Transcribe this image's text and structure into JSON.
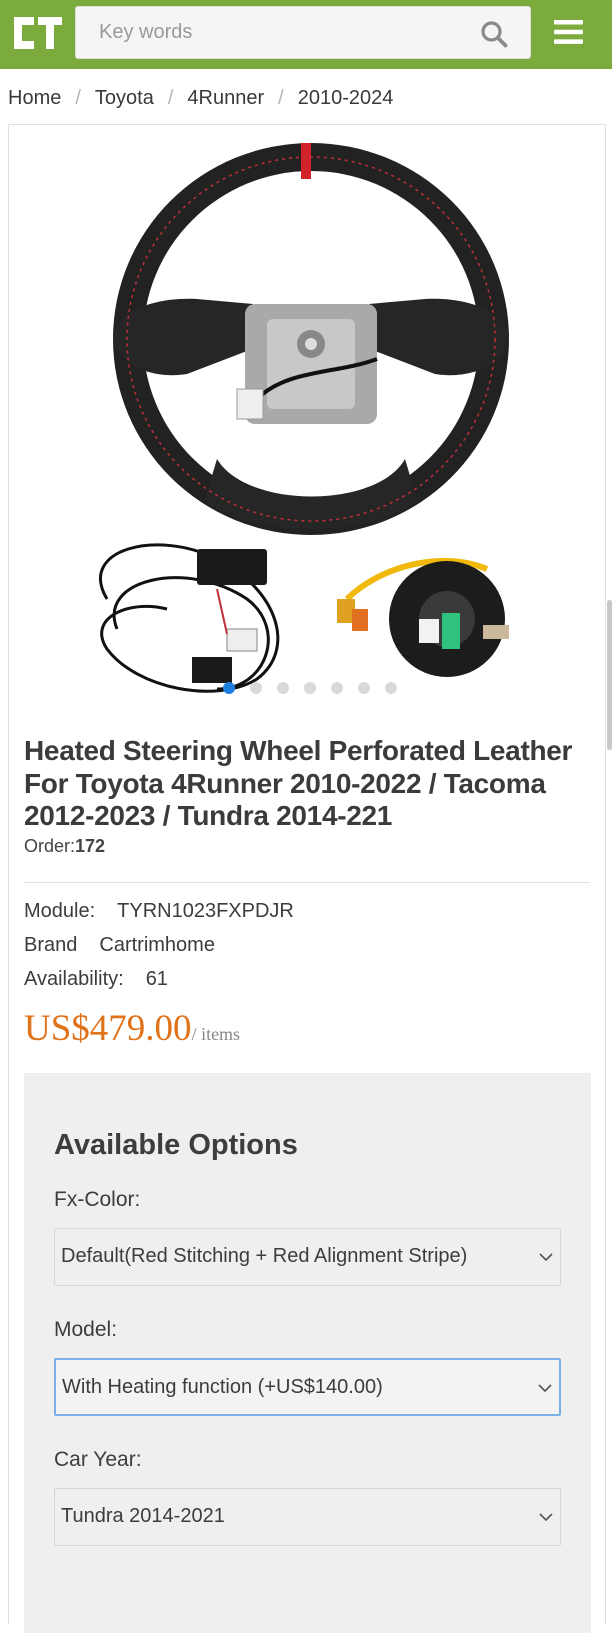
{
  "header": {
    "logo_text": "CT",
    "search_placeholder": "Key words",
    "brand_color": "#7cab3d"
  },
  "breadcrumb": [
    "Home",
    "Toyota",
    "4Runner",
    "2010-2024"
  ],
  "product": {
    "title": "Heated Steering Wheel Perforated Leather For Toyota 4Runner 2010-2022 / Tacoma 2012-2023 / Tundra 2014-221",
    "order_label": "Order:",
    "order_value": "172",
    "specs": [
      {
        "label": "Module:",
        "value": "TYRN1023FXPDJR"
      },
      {
        "label": "Brand",
        "value": "Cartrimhome"
      },
      {
        "label": "Availability:",
        "value": "61"
      }
    ],
    "price": "US$479.00",
    "price_unit": "/ items",
    "price_color": "#e0721a",
    "gallery_dots": 7,
    "gallery_active_index": 0
  },
  "options": {
    "heading": "Available Options",
    "fields": [
      {
        "label": "Fx-Color:",
        "selected": "Default(Red Stitching + Red Alignment Stripe)"
      },
      {
        "label": "Model:",
        "selected": "With Heating function (+US$140.00)"
      },
      {
        "label": "Car Year:",
        "selected": "Tundra 2014-2021"
      }
    ]
  }
}
